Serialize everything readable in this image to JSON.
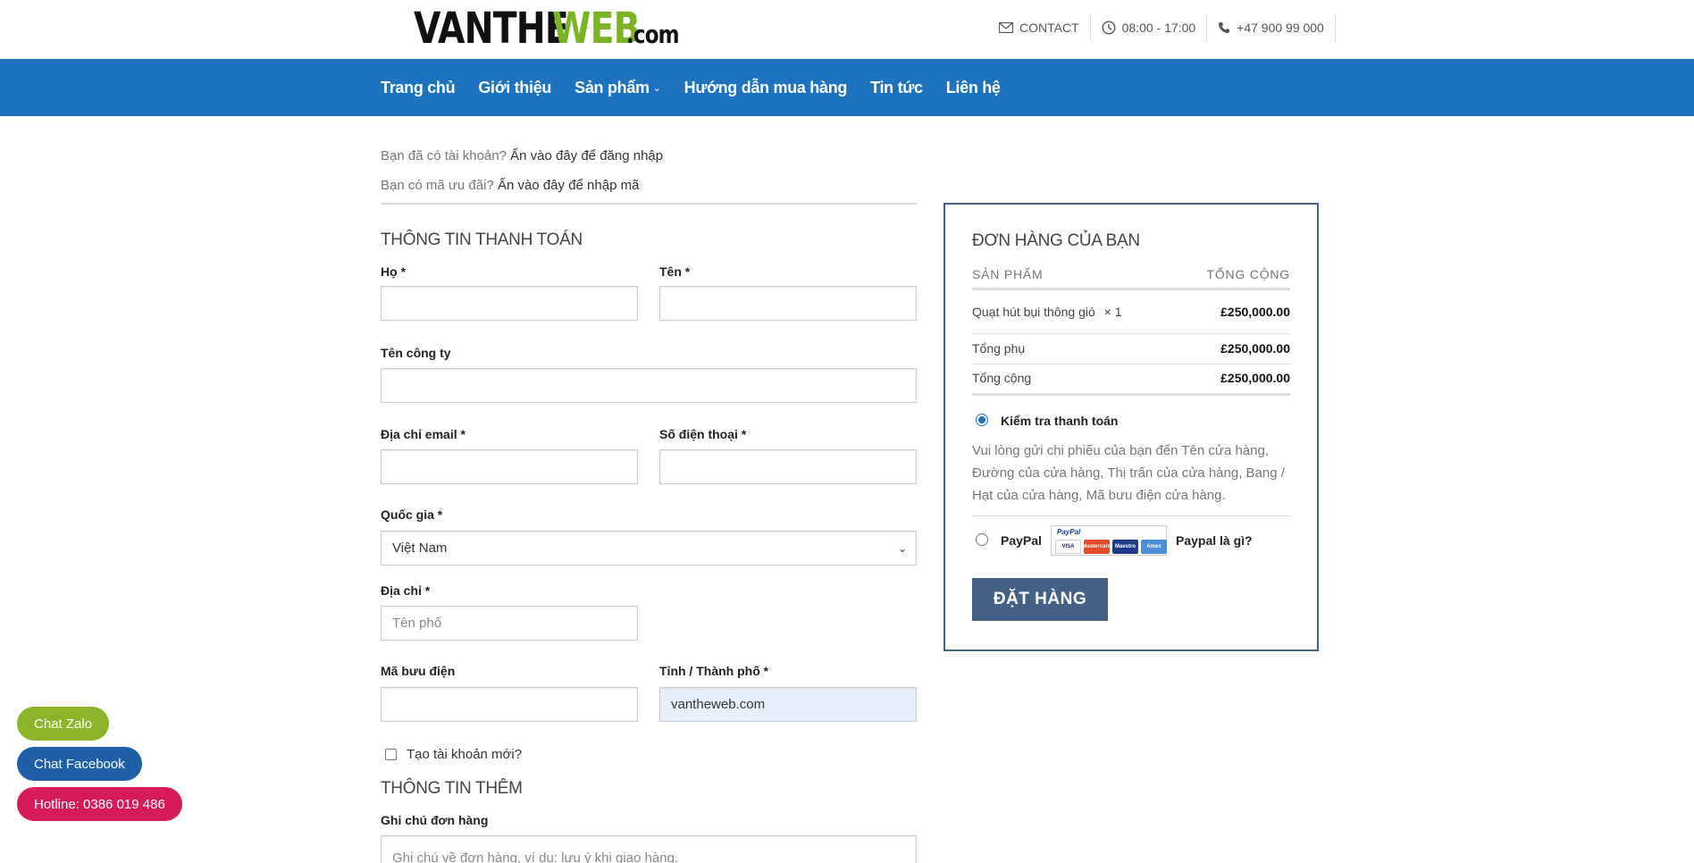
{
  "header": {
    "logo": {
      "part1": "VANTHE",
      "part2": "WEB",
      "part3": ".com"
    },
    "contact_label": "CONTACT",
    "hours": "08:00 - 17:00",
    "phone": "+47 900 99 000"
  },
  "nav": {
    "items": [
      "Trang chủ",
      "Giới thiệu",
      "Sản phẩm",
      "Hướng dẫn mua hàng",
      "Tin tức",
      "Liên hệ"
    ]
  },
  "notices": {
    "login_prefix": "Bạn đã có tài khoản?",
    "login_link": "Ấn vào đây để đăng nhập",
    "coupon_prefix": "Bạn có mã ưu đãi?",
    "coupon_link": "Ấn vào đây để nhập mã"
  },
  "billing": {
    "title": "THÔNG TIN THANH TOÁN",
    "last_name_label": "Họ",
    "first_name_label": "Tên",
    "company_label": "Tên công ty",
    "email_label": "Địa chỉ email",
    "phone_label": "Số điện thoại",
    "country_label": "Quốc gia",
    "country_value": "Việt Nam",
    "address_label": "Địa chỉ",
    "address_placeholder": "Tên phố",
    "postcode_label": "Mã bưu điện",
    "city_label": "Tỉnh / Thành phố",
    "city_value": "vantheweb.com",
    "create_account_label": "Tạo tài khoản mới?",
    "required_mark": "*"
  },
  "additional": {
    "title": "THÔNG TIN THÊM",
    "notes_label": "Ghi chú đơn hàng",
    "notes_placeholder": "Ghi chú về đơn hàng, ví dụ: lưu ý khi giao hàng."
  },
  "order": {
    "title": "ĐƠN HÀNG CỦA BẠN",
    "col_product": "SẢN PHẨM",
    "col_total": "TỔNG CỘNG",
    "item_name": "Quạt hút bụi thông gió",
    "item_qty": "× 1",
    "item_price": "£250,000.00",
    "subtotal_label": "Tổng phụ",
    "subtotal_value": "£250,000.00",
    "total_label": "Tổng cộng",
    "total_value": "£250,000.00",
    "payment_cheque": "Kiểm tra thanh toán",
    "cheque_desc": "Vui lòng gửi chi phiếu của bạn đến Tên cửa hàng, Đường của cửa hàng, Thị trấn của cửa hàng, Bang / Hạt của cửa hàng, Mã bưu điện cửa hàng.",
    "payment_paypal": "PayPal",
    "paypal_logo_text": "PayPal",
    "paypal_link": "Paypal là gì?",
    "place_order": "ĐẶT HÀNG",
    "cards": [
      "VISA",
      "Mastercard",
      "Maestro",
      "Amex"
    ]
  },
  "floating": {
    "zalo": "Chat Zalo",
    "facebook": "Chat Facebook",
    "hotline": "Hotline: 0386 019 486"
  },
  "colors": {
    "nav_bg": "#1e73be",
    "logo_green": "#7cb324",
    "button_bg": "#446084",
    "zalo": "#8cb42a",
    "facebook": "#1f5ea8",
    "hotline": "#d61b5c"
  }
}
